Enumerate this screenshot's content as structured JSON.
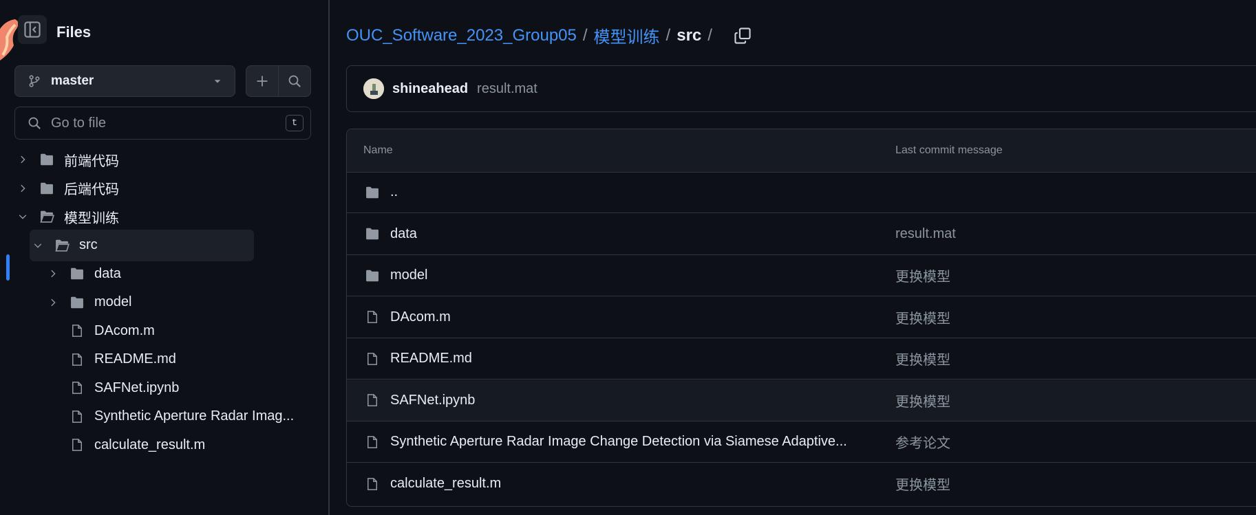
{
  "colors": {
    "background": "#0d1117",
    "border": "#30363d",
    "link": "#4493f8",
    "muted": "#8b949e",
    "text": "#e6edf3",
    "selection_accent": "#2f81f7"
  },
  "sidebar": {
    "title": "Files",
    "toggle_icon": "sidebar-collapse-icon",
    "branch": {
      "name": "master",
      "icon": "git-branch-icon",
      "dropdown_icon": "triangle-down-icon"
    },
    "add_icon": "plus-icon",
    "search_icon": "search-icon",
    "goto": {
      "placeholder": "Go to file",
      "shortcut": "t"
    },
    "tree": [
      {
        "label": "前端代码",
        "type": "folder",
        "expanded": false,
        "depth": 0
      },
      {
        "label": "后端代码",
        "type": "folder",
        "expanded": false,
        "depth": 0
      },
      {
        "label": "模型训练",
        "type": "folder",
        "expanded": true,
        "depth": 0
      },
      {
        "label": "src",
        "type": "folder",
        "expanded": true,
        "depth": 1,
        "selected": true
      },
      {
        "label": "data",
        "type": "folder",
        "expanded": false,
        "depth": 2
      },
      {
        "label": "model",
        "type": "folder",
        "expanded": false,
        "depth": 2
      },
      {
        "label": "DAcom.m",
        "type": "file",
        "depth": 2
      },
      {
        "label": "README.md",
        "type": "file",
        "depth": 2
      },
      {
        "label": "SAFNet.ipynb",
        "type": "file",
        "depth": 2
      },
      {
        "label": "Synthetic Aperture Radar Imag...",
        "type": "file",
        "depth": 2
      },
      {
        "label": "calculate_result.m",
        "type": "file",
        "depth": 2
      }
    ]
  },
  "breadcrumb": {
    "repo": "OUC_Software_2023_Group05",
    "folder": "模型训练",
    "current": "src",
    "separator": "/",
    "copy_icon": "copy-icon"
  },
  "latest_commit": {
    "author": "shineahead",
    "message": "result.mat"
  },
  "table": {
    "headers": {
      "name": "Name",
      "message": "Last commit message"
    },
    "rows": [
      {
        "name": "..",
        "type": "folder",
        "message": ""
      },
      {
        "name": "data",
        "type": "folder",
        "message": "result.mat"
      },
      {
        "name": "model",
        "type": "folder",
        "message": "更换模型"
      },
      {
        "name": "DAcom.m",
        "type": "file",
        "message": "更换模型"
      },
      {
        "name": "README.md",
        "type": "file",
        "message": "更换模型"
      },
      {
        "name": "SAFNet.ipynb",
        "type": "file",
        "message": "更换模型"
      },
      {
        "name": "Synthetic Aperture Radar Image Change Detection via Siamese Adaptive...",
        "type": "file",
        "message": "参考论文"
      },
      {
        "name": "calculate_result.m",
        "type": "file",
        "message": "更换模型"
      }
    ]
  }
}
